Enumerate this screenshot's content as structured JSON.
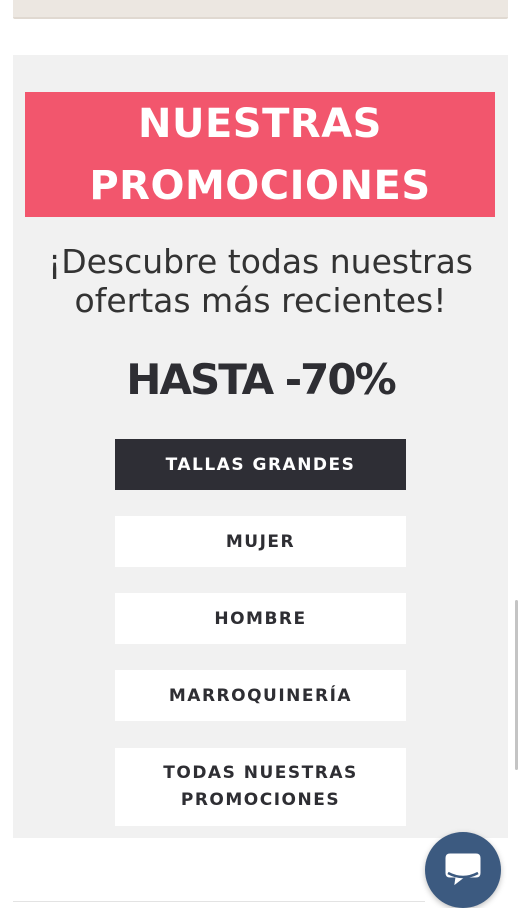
{
  "banner": {
    "line1": "NUESTRAS",
    "line2": "PROMOCIONES"
  },
  "subtitle": {
    "line1": "¡Descubre todas nuestras",
    "line2": "ofertas más recientes!"
  },
  "discount": {
    "text": "HASTA -70%"
  },
  "categories": [
    {
      "label": "TALLAS GRANDES",
      "active": true
    },
    {
      "label": "MUJER",
      "active": false
    },
    {
      "label": "HOMBRE",
      "active": false
    },
    {
      "label": "MARROQUINERÍA",
      "active": false
    },
    {
      "label_line1": "TODAS NUESTRAS",
      "label_line2": "PROMOCIONES",
      "active": false
    }
  ],
  "chat": {
    "icon": "chat-bubble-icon"
  },
  "colors": {
    "banner_bg": "#f2566d",
    "panel_bg": "#f1f1f1",
    "active_button_bg": "#2e2e35",
    "chat_button_bg": "#3c5a80"
  }
}
